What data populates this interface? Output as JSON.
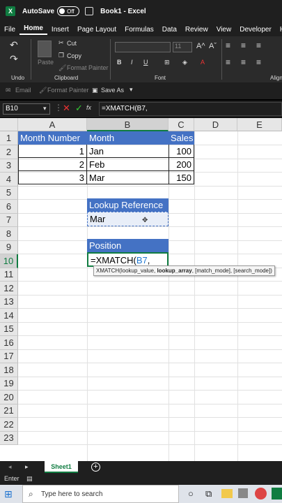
{
  "titlebar": {
    "autosave_label": "AutoSave",
    "autosave_state": "Off",
    "document_title": "Book1 - Excel"
  },
  "menu": [
    "File",
    "Home",
    "Insert",
    "Page Layout",
    "Formulas",
    "Data",
    "Review",
    "View",
    "Developer",
    "Help"
  ],
  "menu_active": "Home",
  "ribbon": {
    "undo_label": "Undo",
    "clipboard_label": "Clipboard",
    "paste_label": "Paste",
    "cut_label": "Cut",
    "copy_label": "Copy",
    "format_painter_label": "Format Painter",
    "font_label": "Font",
    "font_size": "11",
    "bold": "B",
    "italic": "I",
    "underline": "U",
    "align_label": "Align"
  },
  "qat": {
    "email": "Email",
    "format_painter": "Format Painter",
    "save_as": "Save As"
  },
  "formula_bar": {
    "name_box": "B10",
    "fx": "fx",
    "formula": "=XMATCH(B7,"
  },
  "columns": [
    "A",
    "B",
    "C",
    "D",
    "E"
  ],
  "rows": [
    "1",
    "2",
    "3",
    "4",
    "5",
    "6",
    "7",
    "8",
    "9",
    "10",
    "11",
    "12",
    "13",
    "14",
    "15",
    "16",
    "17",
    "18",
    "19",
    "20",
    "21",
    "22",
    "23"
  ],
  "cells": {
    "A1": "Month Number",
    "B1": "Month",
    "C1": "Sales",
    "A2": "1",
    "B2": "Jan",
    "C2": "100",
    "A3": "2",
    "B3": "Feb",
    "C3": "200",
    "A4": "3",
    "B4": "Mar",
    "C4": "150",
    "B6": "Lookup Reference",
    "B7": "Mar",
    "B9": "Position",
    "B10_prefix": "=XMATCH(",
    "B10_ref": "B7",
    "B10_suffix": ","
  },
  "tooltip": {
    "fn": "XMATCH(lookup_value, ",
    "current": "lookup_array",
    "rest": ", [match_mode], [search_mode])"
  },
  "sheet_tab": "Sheet1",
  "add_sheet": "+",
  "status": "Enter",
  "taskbar": {
    "search_placeholder": "Type here to search"
  },
  "colors": {
    "header_blue": "#4472c4",
    "excel_green": "#107c41",
    "ref_blue": "#1f78d1"
  }
}
